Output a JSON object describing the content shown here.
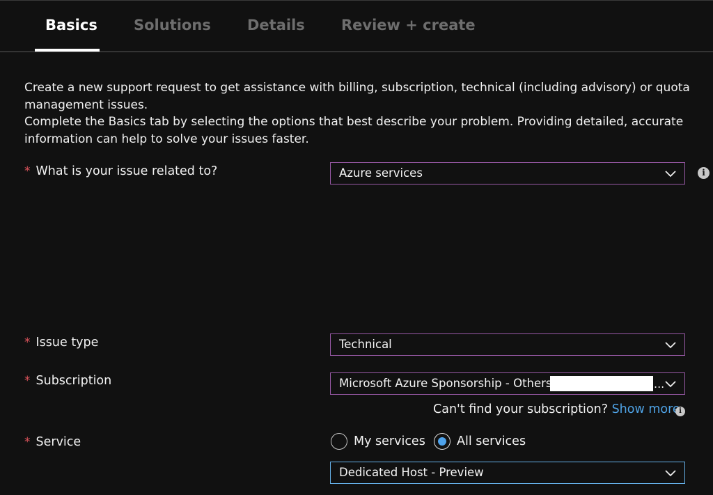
{
  "tabs": [
    {
      "label": "Basics",
      "active": true
    },
    {
      "label": "Solutions",
      "active": false
    },
    {
      "label": "Details",
      "active": false
    },
    {
      "label": "Review + create",
      "active": false
    }
  ],
  "intro": {
    "line1": "Create a new support request to get assistance with billing, subscription, technical (including advisory) or quota management issues.",
    "line2": "Complete the Basics tab by selecting the options that best describe your problem. Providing detailed, accurate information can help to solve your issues faster."
  },
  "required_marker": "*",
  "fields": {
    "issue_related": {
      "label": "What is your issue related to?",
      "value": "Azure services"
    },
    "issue_type": {
      "label": "Issue type",
      "value": "Technical"
    },
    "subscription": {
      "label": "Subscription",
      "value": "Microsoft Azure Sponsorship - Others (a",
      "ellipsis": "..."
    },
    "service": {
      "label": "Service",
      "value": "Dedicated Host - Preview"
    }
  },
  "subscription_hint": {
    "text": "Can't find your subscription?",
    "link": "Show more"
  },
  "service_options": [
    {
      "label": "My services",
      "selected": false
    },
    {
      "label": "All services",
      "selected": true
    }
  ],
  "icons": {
    "chevron": "chevron-down-icon",
    "info": "info-icon"
  },
  "colors": {
    "background": "#111111",
    "accent_link": "#4fa3e6",
    "required": "#e0555d",
    "dropdown_border": "#9a5aa8",
    "focused_border": "#66b1ea"
  }
}
